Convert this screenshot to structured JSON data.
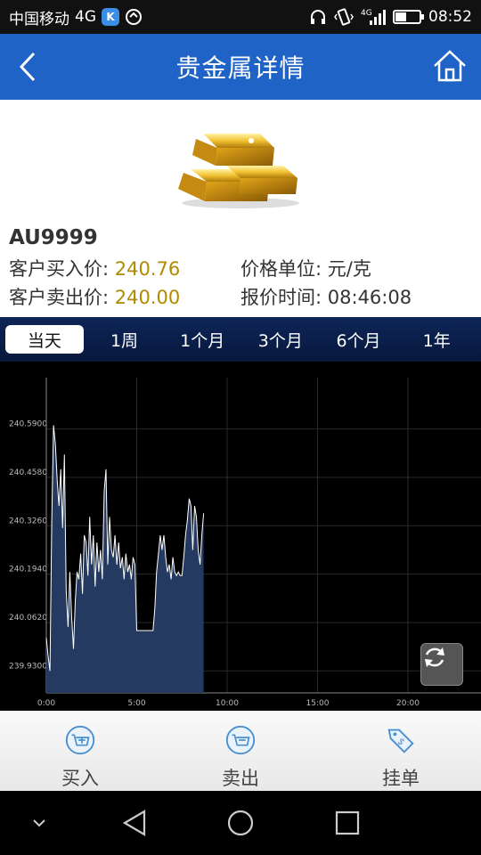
{
  "status_bar": {
    "carrier": "中国移动",
    "network": "4G",
    "badge": "K",
    "signal_label": "4G",
    "battery_level": 0.45,
    "time": "08:52"
  },
  "header": {
    "title": "贵金属详情"
  },
  "product": {
    "code": "AU9999",
    "buy_label": "客户买入价:",
    "buy_value": "240.76",
    "unit_label": "价格单位:",
    "unit_value": "元/克",
    "sell_label": "客户卖出价:",
    "sell_value": "240.00",
    "time_label": "报价时间:",
    "time_value": "08:46:08"
  },
  "tabs": [
    {
      "label": "当天",
      "active": true
    },
    {
      "label": "1周",
      "active": false
    },
    {
      "label": "1个月",
      "active": false
    },
    {
      "label": "3个月",
      "active": false
    },
    {
      "label": "6个月",
      "active": false
    },
    {
      "label": "1年",
      "active": false
    }
  ],
  "chart_data": {
    "type": "area",
    "title": "",
    "xlabel": "",
    "ylabel": "",
    "x_ticks": [
      "0:00",
      "5:00",
      "10:00",
      "15:00",
      "20:00"
    ],
    "y_ticks": [
      "239.9300",
      "240.0620",
      "240.1940",
      "240.3260",
      "240.4580",
      "240.5900"
    ],
    "xlim_hours": [
      0,
      24
    ],
    "ylim": [
      239.87,
      240.73
    ],
    "grid": true,
    "fill_color": "#253a61",
    "line_color": "#ffffff",
    "series": [
      {
        "x": [
          0.0,
          0.1,
          0.2,
          0.3,
          0.4,
          0.5,
          0.55,
          0.6,
          0.7,
          0.8,
          0.9,
          1.0,
          1.1,
          1.2,
          1.3,
          1.4,
          1.5,
          1.6,
          1.7,
          1.8,
          1.9,
          2.0,
          2.1,
          2.2,
          2.3,
          2.4,
          2.5,
          2.6,
          2.7,
          2.8,
          2.9,
          3.0,
          3.1,
          3.2,
          3.3,
          3.4,
          3.5,
          3.6,
          3.7,
          3.8,
          3.9,
          4.0,
          4.1,
          4.2,
          4.3,
          4.4,
          4.5,
          4.6,
          4.7,
          4.8,
          4.9,
          5.0,
          5.1,
          5.5,
          5.9,
          6.0,
          6.1,
          6.2,
          6.3,
          6.4,
          6.5,
          6.6,
          6.7,
          6.8,
          6.9,
          7.0,
          7.1,
          7.2,
          7.3,
          7.4,
          7.5,
          7.6,
          7.7,
          7.8,
          7.9,
          8.0,
          8.1,
          8.2,
          8.3,
          8.4,
          8.5,
          8.6,
          8.7
        ],
        "y": [
          240.02,
          239.97,
          239.93,
          240.34,
          240.6,
          240.55,
          240.5,
          240.45,
          240.38,
          240.48,
          240.32,
          240.52,
          240.15,
          240.05,
          240.2,
          240.08,
          239.99,
          240.12,
          240.2,
          240.18,
          240.25,
          240.14,
          240.3,
          240.28,
          240.19,
          240.35,
          240.22,
          240.3,
          240.16,
          240.28,
          240.2,
          240.26,
          240.18,
          240.42,
          240.48,
          240.22,
          240.35,
          240.26,
          240.24,
          240.3,
          240.22,
          240.28,
          240.21,
          240.24,
          240.18,
          240.25,
          240.2,
          240.22,
          240.18,
          240.24,
          240.22,
          240.04,
          240.04,
          240.04,
          240.04,
          240.1,
          240.2,
          240.25,
          240.3,
          240.26,
          240.3,
          240.24,
          240.2,
          240.22,
          240.18,
          240.24,
          240.2,
          240.19,
          240.2,
          240.19,
          240.19,
          240.24,
          240.3,
          240.34,
          240.4,
          240.38,
          240.26,
          240.38,
          240.35,
          240.26,
          240.22,
          240.3,
          240.36
        ]
      }
    ]
  },
  "actions": [
    {
      "label": "买入",
      "icon": "buy-plus-icon"
    },
    {
      "label": "卖出",
      "icon": "sell-cart-icon"
    },
    {
      "label": "挂单",
      "icon": "price-tag-icon"
    }
  ],
  "nav": {
    "icons": [
      "chevron-down-icon",
      "back-triangle-icon",
      "home-circle-icon",
      "recents-square-icon"
    ]
  }
}
